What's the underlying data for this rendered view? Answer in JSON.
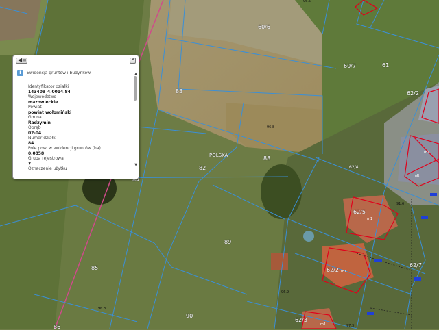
{
  "popup": {
    "title": "Ewidencja gruntów i budynków",
    "fields": [
      {
        "label": "Identyfikator działki",
        "value": "143409_4.0014.84"
      },
      {
        "label": "Województwo",
        "value": "mazowieckie"
      },
      {
        "label": "Powiat",
        "value": "powiat wołomiński"
      },
      {
        "label": "Gmina",
        "value": "Radzymin"
      },
      {
        "label": "Obręb",
        "value": "02-04"
      },
      {
        "label": "Numer działki",
        "value": "84"
      },
      {
        "label": "Pole pow. w ewidencji gruntów (ha)",
        "value": "0.0858"
      },
      {
        "label": "Grupa rejestrowa",
        "value": "7"
      },
      {
        "label": "Oznaczenie użytku",
        "value": ""
      }
    ]
  },
  "parcels": {
    "p60_6": "60/6",
    "p60_7": "60/7",
    "p61": "61",
    "p62_2_top": "62/2",
    "p62_4": "62/4",
    "p62_5": "62/5",
    "p62_7": "62/7",
    "p62_2_mid": "62/2",
    "p62_3": "62/3",
    "p83": "83",
    "p84": "84",
    "p85": "85",
    "p86": "86",
    "p88": "88",
    "p89": "89",
    "p90": "90",
    "p82": "82",
    "polska": "POLSKA"
  },
  "small_labels": {
    "e1": "96.8",
    "e2": "96.8",
    "e3": "96.9",
    "e4": "96.5",
    "e5": "91.6",
    "e6": "97.3",
    "m1": "m1",
    "m2": "m1",
    "m3": "m1",
    "m4": "mR",
    "m5": "m1"
  },
  "colors": {
    "parcel_line": "#3b8fd6",
    "building": "#e0001b",
    "road_pink": "#d04a8a"
  }
}
